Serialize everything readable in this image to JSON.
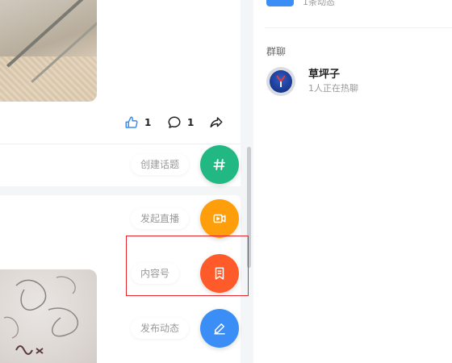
{
  "post": {
    "likes": "1",
    "comments": "1"
  },
  "sidebar": {
    "top_text": "1条动态",
    "section_title": "群聊",
    "group": {
      "name": "草坪子",
      "status": "1人正在热聊"
    }
  },
  "fab": {
    "items": [
      {
        "label": "创建话题",
        "icon": "hash-icon",
        "color": "#21b883"
      },
      {
        "label": "发起直播",
        "icon": "live-camera-icon",
        "color": "#ff9e0b"
      },
      {
        "label": "内容号",
        "icon": "bookmark-doc-icon",
        "color": "#ff5b2a"
      },
      {
        "label": "发布动态",
        "icon": "edit-pen-icon",
        "color": "#3a8ef6"
      }
    ]
  },
  "colors": {
    "highlight": "#e5262d",
    "like_icon": "#3a8ef6"
  }
}
